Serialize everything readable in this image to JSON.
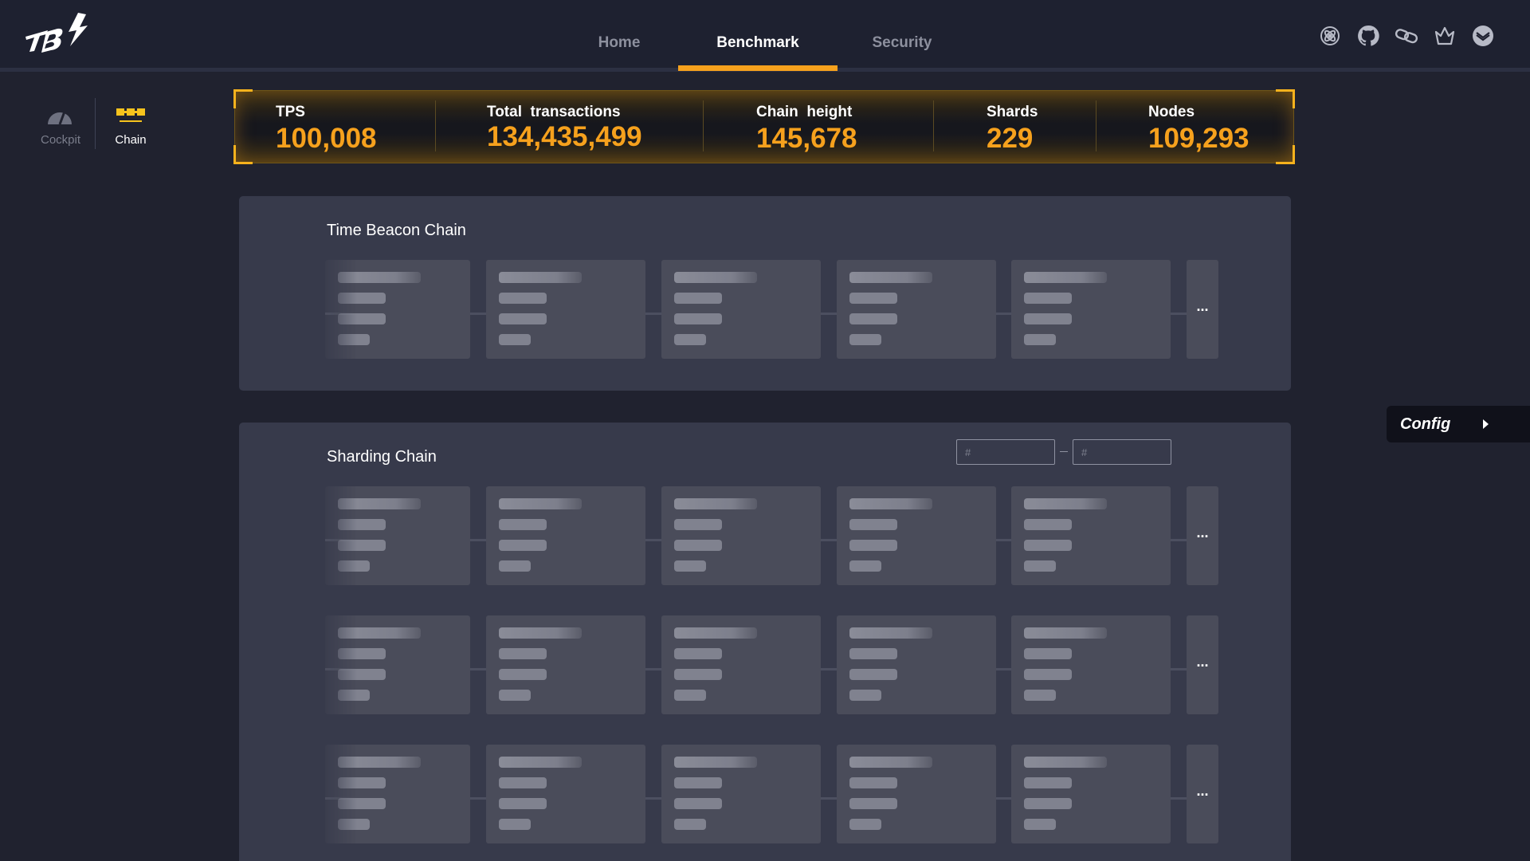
{
  "header": {
    "nav": [
      {
        "label": "Home",
        "active": false
      },
      {
        "label": "Benchmark",
        "active": true
      },
      {
        "label": "Security",
        "active": false
      }
    ],
    "icons": [
      "atom-icon",
      "github-icon",
      "chain-link-icon",
      "crown-icon",
      "mail-icon"
    ]
  },
  "sidebar": {
    "items": [
      {
        "label": "Cockpit",
        "icon": "speedometer-icon",
        "active": false
      },
      {
        "label": "Chain",
        "icon": "chain-blocks-icon",
        "active": true
      }
    ]
  },
  "stats": [
    {
      "label": "TPS",
      "value": "100,008"
    },
    {
      "label": "Total  transactions",
      "value": "134,435,499"
    },
    {
      "label": "Chain  height",
      "value": "145,678"
    },
    {
      "label": "Shards",
      "value": "229"
    },
    {
      "label": "Nodes",
      "value": "109,293"
    }
  ],
  "beacon": {
    "title": "Time Beacon Chain",
    "more": "..."
  },
  "sharding": {
    "title": "Sharding Chain",
    "range_from_placeholder": "#",
    "range_to_placeholder": "#",
    "more": "..."
  },
  "config": {
    "label": "Config"
  },
  "colors": {
    "accent": "#f6a11d",
    "background": "#20222f",
    "panel": "#373a4b",
    "block": "#4a4c5a"
  }
}
